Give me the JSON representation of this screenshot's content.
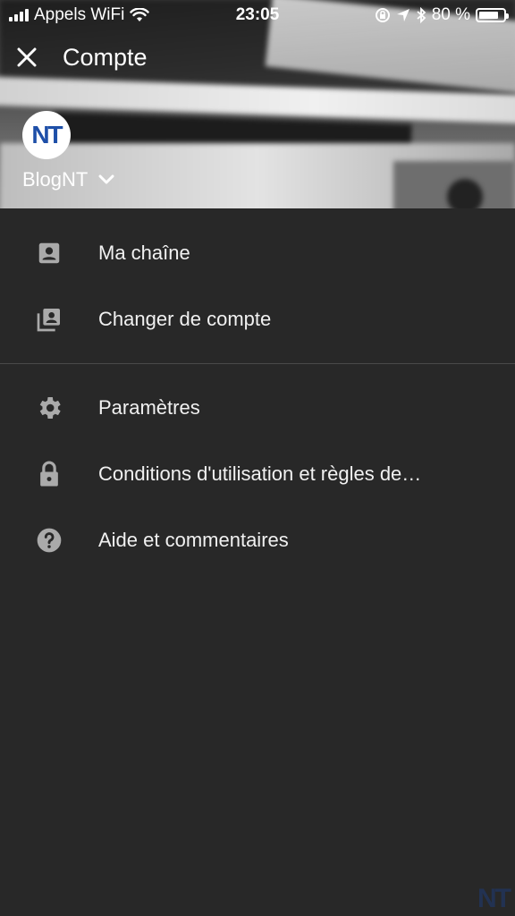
{
  "status_bar": {
    "carrier": "Appels WiFi",
    "time": "23:05",
    "battery_percent": "80 %",
    "battery_level": 0.8
  },
  "header": {
    "title": "Compte",
    "close_icon": "close-icon",
    "account_name": "BlogNT",
    "avatar_text": "NT"
  },
  "menu": {
    "items": [
      {
        "label": "Ma chaîne",
        "icon": "person-box-icon"
      },
      {
        "label": "Changer de compte",
        "icon": "switch-account-icon"
      },
      {
        "label": "Paramètres",
        "icon": "gear-icon"
      },
      {
        "label": "Conditions d'utilisation et règles de…",
        "icon": "lock-icon"
      },
      {
        "label": "Aide et commentaires",
        "icon": "help-icon"
      }
    ]
  },
  "watermark": "NT",
  "colors": {
    "background": "#282828",
    "text": "#f1f1f1",
    "icon": "#aaaaaa",
    "divider": "#4a4a4a"
  }
}
